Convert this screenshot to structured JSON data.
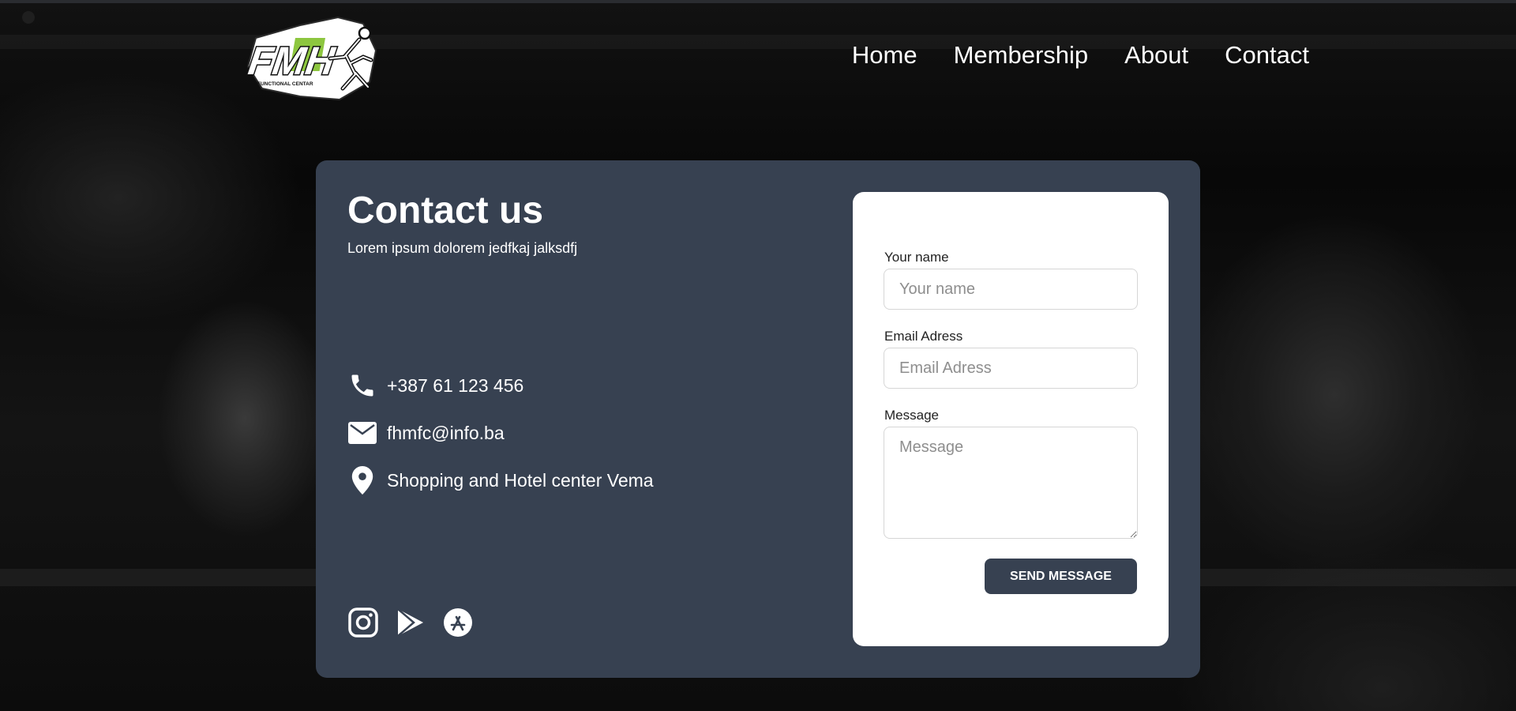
{
  "logo": {
    "text": "FMH",
    "tagline": "FUNCTIONAL CENTAR"
  },
  "nav": {
    "items": [
      "Home",
      "Membership",
      "About",
      "Contact"
    ]
  },
  "contact": {
    "title": "Contact us",
    "subtitle": "Lorem ipsum dolorem jedfkaj jalksdfj",
    "phone": "+387 61 123 456",
    "email": "fhmfc@info.ba",
    "address": "Shopping and Hotel center Vema",
    "social_icons": [
      "instagram-icon",
      "google-play-icon",
      "app-store-icon"
    ]
  },
  "form": {
    "name_label": "Your name",
    "name_placeholder": "Your name",
    "email_label": "Email Adress",
    "email_placeholder": "Email Adress",
    "message_label": "Message",
    "message_placeholder": "Message",
    "submit_label": "SEND MESSAGE"
  },
  "colors": {
    "card_bg": "#374151",
    "logo_green": "#8dc63f",
    "text_white": "#ffffff"
  }
}
